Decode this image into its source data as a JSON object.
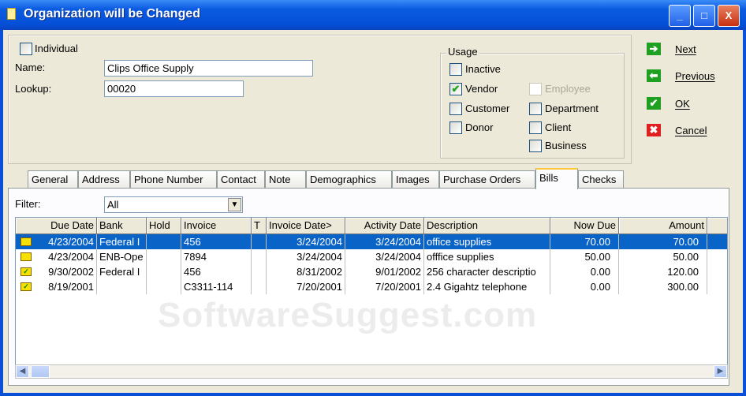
{
  "window": {
    "title": "Organization will be Changed",
    "minimize": "_",
    "maximize": "□",
    "close": "X"
  },
  "form": {
    "individual_label": "Individual",
    "name_label": "Name:",
    "name_value": "Clips Office Supply",
    "lookup_label": "Lookup:",
    "lookup_value": "00020"
  },
  "usage": {
    "title": "Usage",
    "items": [
      {
        "label": "Inactive",
        "checked": false,
        "disabled": false
      },
      {
        "label": "Vendor",
        "checked": true,
        "disabled": false
      },
      {
        "label": "Employee",
        "checked": false,
        "disabled": true
      },
      {
        "label": "Customer",
        "checked": false,
        "disabled": false
      },
      {
        "label": "Department",
        "checked": false,
        "disabled": false
      },
      {
        "label": "Donor",
        "checked": false,
        "disabled": false
      },
      {
        "label": "Client",
        "checked": false,
        "disabled": false
      },
      {
        "label": "Business",
        "checked": false,
        "disabled": false
      }
    ]
  },
  "nav": {
    "next": "Next",
    "previous": "Previous",
    "ok": "OK",
    "cancel": "Cancel"
  },
  "tabs": [
    "General",
    "Address",
    "Phone Number",
    "Contact",
    "Note",
    "Demographics",
    "Images",
    "Purchase Orders",
    "Bills",
    "Checks"
  ],
  "active_tab": "Bills",
  "filter": {
    "label": "Filter:",
    "value": "All"
  },
  "table": {
    "columns": [
      "Due Date",
      "Bank",
      "Hold",
      "Invoice",
      "T",
      "Invoice Date>",
      "Activity Date",
      "Description",
      "Now Due",
      "Amount"
    ],
    "rows": [
      {
        "paid": false,
        "due": "4/23/2004",
        "bank": "Federal I",
        "hold": "",
        "invoice": "456",
        "t": "",
        "inv_date": "3/24/2004",
        "act_date": "3/24/2004",
        "desc": "office supplies",
        "now_due": "70.00",
        "amount": "70.00"
      },
      {
        "paid": false,
        "due": "4/23/2004",
        "bank": "ENB-Ope",
        "hold": "",
        "invoice": "7894",
        "t": "",
        "inv_date": "3/24/2004",
        "act_date": "3/24/2004",
        "desc": "offfice supplies",
        "now_due": "50.00",
        "amount": "50.00"
      },
      {
        "paid": true,
        "due": "9/30/2002",
        "bank": "Federal I",
        "hold": "",
        "invoice": "456",
        "t": "",
        "inv_date": "8/31/2002",
        "act_date": "9/01/2002",
        "desc": "256 character descriptio",
        "now_due": "0.00",
        "amount": "120.00"
      },
      {
        "paid": true,
        "due": "8/19/2001",
        "bank": "",
        "hold": "",
        "invoice": "C3311-114",
        "t": "",
        "inv_date": "7/20/2001",
        "act_date": "7/20/2001",
        "desc": "2.4 Gigahtz telephone",
        "now_due": "0.00",
        "amount": "300.00"
      }
    ],
    "selected_row": 0
  },
  "watermark": "SoftwareSuggest.com"
}
